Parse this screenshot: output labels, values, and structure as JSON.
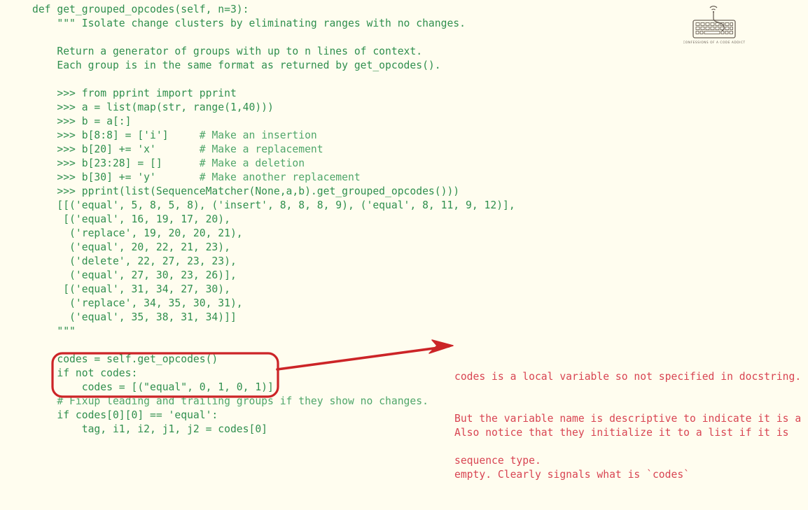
{
  "page": {
    "background_color": "#fffdef",
    "code_color": "#2f8f4e",
    "comment_color": "#4fa66a",
    "annotation_color": "#d84452",
    "highlight_box_color": "#cc2427",
    "arrow_color": "#cc2427"
  },
  "code": {
    "language": "python",
    "lines": [
      "def get_grouped_opcodes(self, n=3):",
      "    \"\"\" Isolate change clusters by eliminating ranges with no changes.",
      "",
      "    Return a generator of groups with up to n lines of context.",
      "    Each group is in the same format as returned by get_opcodes().",
      "",
      "    >>> from pprint import pprint",
      "    >>> a = list(map(str, range(1,40)))",
      "    >>> b = a[:]",
      "    >>> b[8:8] = ['i']     # Make an insertion",
      "    >>> b[20] += 'x'       # Make a replacement",
      "    >>> b[23:28] = []      # Make a deletion",
      "    >>> b[30] += 'y'       # Make another replacement",
      "    >>> pprint(list(SequenceMatcher(None,a,b).get_grouped_opcodes()))",
      "    [[('equal', 5, 8, 5, 8), ('insert', 8, 8, 8, 9), ('equal', 8, 11, 9, 12)],",
      "     [('equal', 16, 19, 17, 20),",
      "      ('replace', 19, 20, 20, 21),",
      "      ('equal', 20, 22, 21, 23),",
      "      ('delete', 22, 27, 23, 23),",
      "      ('equal', 27, 30, 23, 26)],",
      "     [('equal', 31, 34, 27, 30),",
      "      ('replace', 34, 35, 30, 31),",
      "      ('equal', 35, 38, 31, 34)]]",
      "    \"\"\"",
      "",
      "    codes = self.get_opcodes()",
      "    if not codes:",
      "        codes = [(\"equal\", 0, 1, 0, 1)]",
      "    # Fixup leading and trailing groups if they show no changes.",
      "    if codes[0][0] == 'equal':",
      "        tag, i1, i2, j1, j2 = codes[0]"
    ],
    "comment_line_indices": [
      9,
      10,
      11,
      12,
      28
    ]
  },
  "highlight_box": {
    "label": "codes-initialization-highlight",
    "covers_lines": [
      "codes = self.get_opcodes()",
      "if not codes:",
      "    codes = [(\"equal\", 0, 1, 0, 1)]"
    ]
  },
  "annotations": [
    {
      "id": "annotation-codes-local-variable",
      "has_arrow": true,
      "lines": [
        "codes is a local variable so not specified in docstring.",
        "But the variable name is descriptive to indicate it is a",
        "sequence type."
      ]
    },
    {
      "id": "annotation-initialize-to-list",
      "has_arrow": false,
      "lines": [
        "Also notice that they initialize it to a list if it is",
        "empty. Clearly signals what is `codes`"
      ]
    }
  ],
  "logo": {
    "name": "confessions-of-a-code-addict-logo",
    "caption": "CONFESSIONS OF A CODE ADDICT",
    "icon": "keyboard-wifi-icon",
    "color": "#6b6258"
  }
}
